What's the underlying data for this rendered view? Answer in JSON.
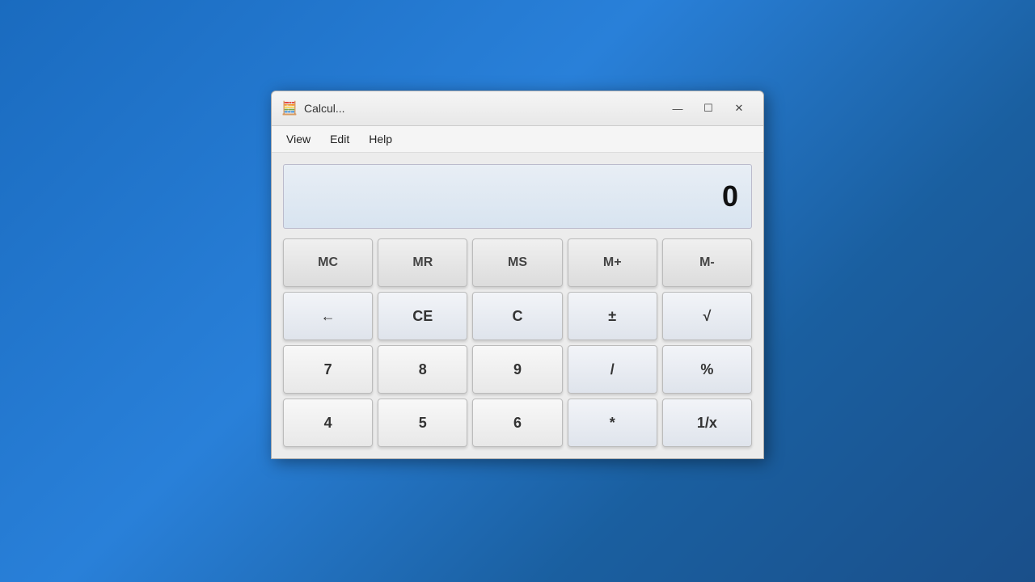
{
  "window": {
    "title": "Calcul...",
    "app_icon": "🧮"
  },
  "titlebar": {
    "minimize_label": "—",
    "maximize_label": "☐",
    "close_label": "✕"
  },
  "menu": {
    "items": [
      {
        "label": "View"
      },
      {
        "label": "Edit"
      },
      {
        "label": "Help"
      }
    ]
  },
  "display": {
    "value": "0"
  },
  "buttons": {
    "memory_row": [
      {
        "id": "mc",
        "label": "MC"
      },
      {
        "id": "mr",
        "label": "MR"
      },
      {
        "id": "ms",
        "label": "MS"
      },
      {
        "id": "mplus",
        "label": "M+"
      },
      {
        "id": "mminus",
        "label": "M-"
      }
    ],
    "control_row": [
      {
        "id": "backspace",
        "label": "←"
      },
      {
        "id": "ce",
        "label": "CE"
      },
      {
        "id": "c",
        "label": "C"
      },
      {
        "id": "plusminus",
        "label": "±"
      },
      {
        "id": "sqrt",
        "label": "√"
      }
    ],
    "row7": [
      {
        "id": "7",
        "label": "7"
      },
      {
        "id": "8",
        "label": "8"
      },
      {
        "id": "9",
        "label": "9"
      },
      {
        "id": "divide",
        "label": "/"
      },
      {
        "id": "percent",
        "label": "%"
      }
    ],
    "row4": [
      {
        "id": "4",
        "label": "4"
      },
      {
        "id": "5",
        "label": "5"
      },
      {
        "id": "6",
        "label": "6"
      },
      {
        "id": "multiply",
        "label": "*"
      },
      {
        "id": "reciprocal",
        "label": "1/x"
      }
    ]
  }
}
